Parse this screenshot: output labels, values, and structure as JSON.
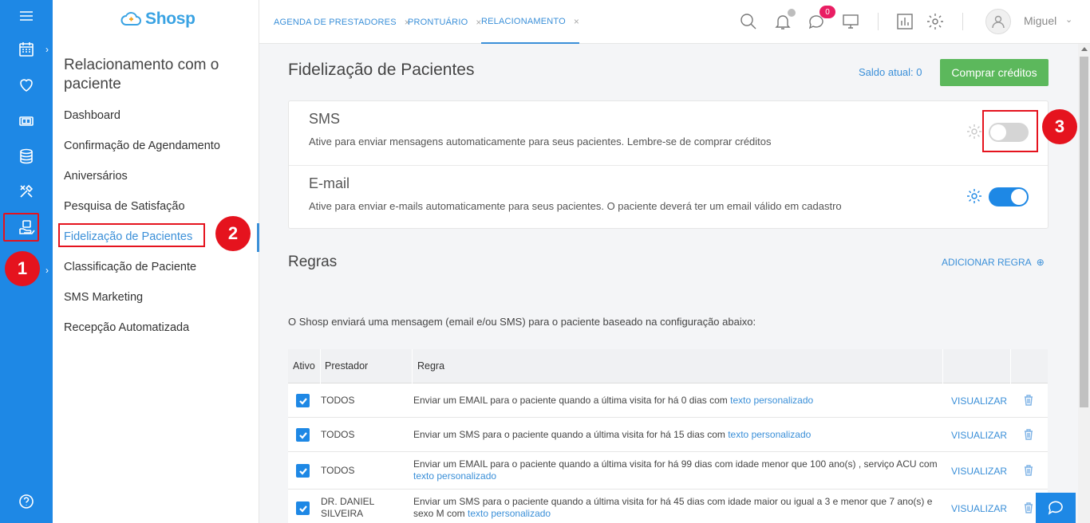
{
  "app": {
    "logo_text": "Shosp"
  },
  "rail": {
    "items": [
      "menu-icon",
      "calendar-icon",
      "heart-icon",
      "cash-icon",
      "database-icon",
      "tools-icon",
      "patient-care-icon",
      "help-icon"
    ]
  },
  "sidebar": {
    "title": "Relacionamento com o paciente",
    "items": [
      {
        "label": "Dashboard"
      },
      {
        "label": "Confirmação de Agendamento"
      },
      {
        "label": "Aniversários"
      },
      {
        "label": "Pesquisa de Satisfação"
      },
      {
        "label": "Fidelização de Pacientes",
        "active": true
      },
      {
        "label": "Classificação de Paciente"
      },
      {
        "label": "SMS Marketing"
      },
      {
        "label": "Recepção Automatizada"
      }
    ]
  },
  "markers": [
    "1",
    "2",
    "3"
  ],
  "header": {
    "tabs": [
      {
        "label": "AGENDA DE PRESTADORES",
        "close": "×"
      },
      {
        "label": "PRONTUÁRIO",
        "close": "×"
      },
      {
        "label": "RELACIONAMENTO",
        "close": "×",
        "active": true
      }
    ],
    "messages_count": "0",
    "user_name": "Miguel",
    "user_caret": "⌄"
  },
  "main": {
    "title": "Fidelização de Pacientes",
    "saldo": "Saldo atual: 0",
    "buy_button": "Comprar créditos",
    "options": [
      {
        "title": "SMS",
        "description": "Ative para enviar mensagens automaticamente para seus pacientes. Lembre-se de comprar créditos",
        "enabled": false
      },
      {
        "title": "E-mail",
        "description": "Ative para enviar e-mails automaticamente para seus pacientes. O paciente deverá ter um email válido em cadastro",
        "enabled": true
      }
    ],
    "rules_title": "Regras",
    "add_rule": "ADICIONAR REGRA",
    "add_rule_icon": "⊕",
    "rules_description": "O Shosp enviará uma mensagem (email e/ou SMS) para o paciente baseado na configuração abaixo:",
    "table": {
      "headers": [
        "Ativo",
        "Prestador",
        "Regra"
      ],
      "rows": [
        {
          "active": true,
          "prestador": "TODOS",
          "regra": "Enviar um EMAIL para o paciente quando a última visita for há 0 dias com",
          "link": "texto personalizado",
          "view": "VISUALIZAR"
        },
        {
          "active": true,
          "prestador": "TODOS",
          "regra": "Enviar um SMS para o paciente quando a última visita for há 15 dias com",
          "link": "texto personalizado",
          "view": "VISUALIZAR"
        },
        {
          "active": true,
          "prestador": "TODOS",
          "regra": "Enviar um EMAIL para o paciente quando a última visita for há 99 dias com idade menor que 100 ano(s) , serviço ACU com",
          "link": "texto personalizado",
          "view": "VISUALIZAR"
        },
        {
          "active": true,
          "prestador": "DR. DANIEL SILVEIRA",
          "regra": "Enviar um SMS para o paciente quando a última visita for há 45 dias com idade maior ou igual a 3 e menor que 7 ano(s) e sexo M com",
          "link": "texto personalizado",
          "view": "VISUALIZAR"
        }
      ]
    }
  },
  "colors": {
    "primary": "#1e88e5",
    "success": "#5cb85c",
    "highlight": "#e5131e",
    "badge": "#e91e63"
  }
}
